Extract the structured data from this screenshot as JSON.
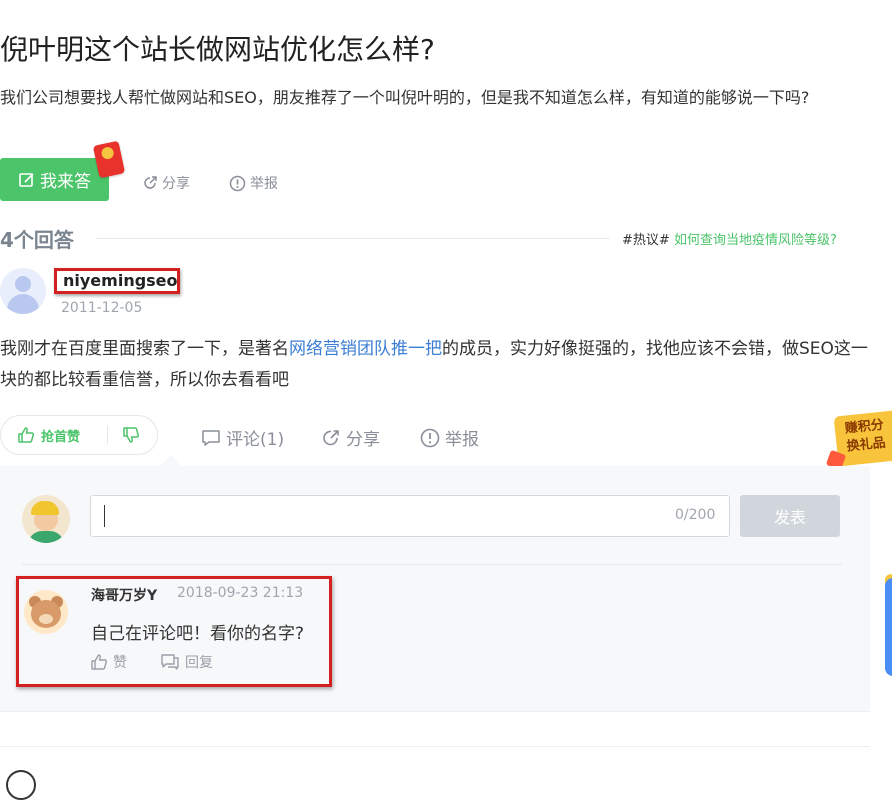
{
  "question": {
    "title": "倪叶明这个站长做网站优化怎么样?",
    "description": "我们公司想要找人帮忙做网站和SEO，朋友推荐了一个叫倪叶明的，但是我不知道怎么样，有知道的能够说一下吗?",
    "answer_button": "我来答",
    "share": "分享",
    "report": "举报"
  },
  "answers_header": {
    "count_label": "4个回答",
    "hot_tag": "#热议#",
    "hot_link": "如何查询当地疫情风险等级?"
  },
  "answer": {
    "username": "niyemingseo",
    "date": "2011-12-05",
    "text_before": "我刚才在百度里面搜索了一下，是著名",
    "text_link": "网络营销团队推一把",
    "text_after": "的成员，实力好像挺强的，找他应该不会错，做SEO这一块的都比较看重信誉，所以你去看看吧",
    "upvote_label": "抢首赞",
    "comment_label": "评论(1)",
    "share_label": "分享",
    "report_label": "举报"
  },
  "reward_badge": {
    "line1": "赚积分",
    "line2": "换礼品"
  },
  "comment_editor": {
    "char_count": "0/200",
    "publish_label": "发表"
  },
  "comment": {
    "author": "海哥万岁Y",
    "time": "2018-09-23 21:13",
    "text": "自己在评论吧！看你的名字?",
    "like_label": "赞",
    "reply_label": "回复"
  },
  "colors": {
    "brand_green": "#4cc46a",
    "link_blue": "#3c7ed4",
    "highlight_red": "#d42020"
  }
}
